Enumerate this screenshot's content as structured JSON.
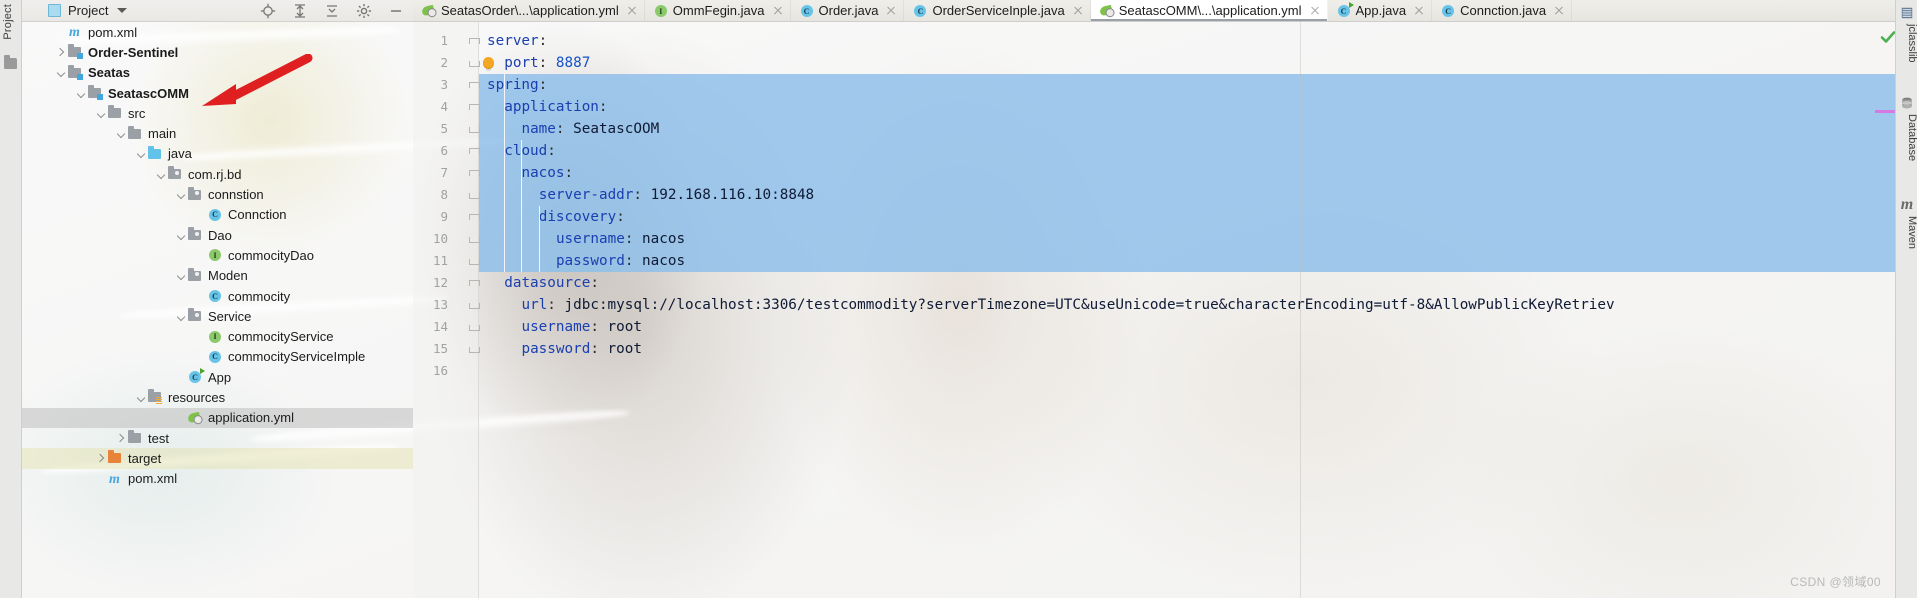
{
  "window": {
    "left_strip_label": "Project",
    "watermark": "CSDN @领域00"
  },
  "project_panel": {
    "title": "Project",
    "header_icons": [
      "locate-icon",
      "expand-all-icon",
      "collapse-all-icon",
      "settings-icon",
      "minimize-icon"
    ],
    "tree": [
      {
        "label": "pom.xml",
        "indent": 1,
        "icon": "maven-pom-icon",
        "arrow": "none",
        "bold": false,
        "state": "normal"
      },
      {
        "label": "Order-Sentinel",
        "indent": 1,
        "icon": "module-folder-icon",
        "arrow": "right",
        "bold": true,
        "state": "normal"
      },
      {
        "label": "Seatas",
        "indent": 1,
        "icon": "module-folder-icon",
        "arrow": "down",
        "bold": true,
        "state": "normal"
      },
      {
        "label": "SeatascOMM",
        "indent": 2,
        "icon": "module-folder-icon",
        "arrow": "down",
        "bold": true,
        "state": "normal"
      },
      {
        "label": "src",
        "indent": 3,
        "icon": "folder-icon",
        "arrow": "down",
        "bold": false,
        "state": "normal"
      },
      {
        "label": "main",
        "indent": 4,
        "icon": "folder-icon",
        "arrow": "down",
        "bold": false,
        "state": "normal"
      },
      {
        "label": "java",
        "indent": 5,
        "icon": "source-folder-icon",
        "arrow": "down",
        "bold": false,
        "state": "normal"
      },
      {
        "label": "com.rj.bd",
        "indent": 6,
        "icon": "package-icon",
        "arrow": "down",
        "bold": false,
        "state": "normal"
      },
      {
        "label": "connstion",
        "indent": 7,
        "icon": "package-icon",
        "arrow": "down",
        "bold": false,
        "state": "normal"
      },
      {
        "label": "Connction",
        "indent": 8,
        "icon": "class-icon",
        "arrow": "none",
        "bold": false,
        "state": "normal"
      },
      {
        "label": "Dao",
        "indent": 7,
        "icon": "package-icon",
        "arrow": "down",
        "bold": false,
        "state": "normal"
      },
      {
        "label": "commocityDao",
        "indent": 8,
        "icon": "interface-icon",
        "arrow": "none",
        "bold": false,
        "state": "normal"
      },
      {
        "label": "Moden",
        "indent": 7,
        "icon": "package-icon",
        "arrow": "down",
        "bold": false,
        "state": "normal"
      },
      {
        "label": "commocity",
        "indent": 8,
        "icon": "class-icon",
        "arrow": "none",
        "bold": false,
        "state": "normal"
      },
      {
        "label": "Service",
        "indent": 7,
        "icon": "package-icon",
        "arrow": "down",
        "bold": false,
        "state": "normal"
      },
      {
        "label": "commocityService",
        "indent": 8,
        "icon": "interface-icon",
        "arrow": "none",
        "bold": false,
        "state": "normal"
      },
      {
        "label": "commocityServiceImple",
        "indent": 8,
        "icon": "class-icon",
        "arrow": "none",
        "bold": false,
        "state": "normal"
      },
      {
        "label": "App",
        "indent": 7,
        "icon": "runnable-class-icon",
        "arrow": "none",
        "bold": false,
        "state": "normal"
      },
      {
        "label": "resources",
        "indent": 5,
        "icon": "resources-folder-icon",
        "arrow": "down",
        "bold": false,
        "state": "normal"
      },
      {
        "label": "application.yml",
        "indent": 7,
        "icon": "spring-yaml-icon",
        "arrow": "none",
        "bold": false,
        "state": "selected"
      },
      {
        "label": "test",
        "indent": 4,
        "icon": "folder-icon",
        "arrow": "right",
        "bold": false,
        "state": "normal"
      },
      {
        "label": "target",
        "indent": 3,
        "icon": "target-folder-icon",
        "arrow": "right",
        "bold": false,
        "state": "highlight"
      },
      {
        "label": "pom.xml",
        "indent": 3,
        "icon": "maven-pom-icon",
        "arrow": "none",
        "bold": false,
        "state": "normal"
      }
    ]
  },
  "editor": {
    "tabs": [
      {
        "label": "SeatasOrder\\...\\application.yml",
        "icon": "spring-yaml-icon",
        "active": false
      },
      {
        "label": "OmmFegin.java",
        "icon": "interface-icon",
        "active": false
      },
      {
        "label": "Order.java",
        "icon": "class-icon",
        "active": false
      },
      {
        "label": "OrderServiceInple.java",
        "icon": "class-icon",
        "active": false
      },
      {
        "label": "SeatascOMM\\...\\application.yml",
        "icon": "spring-yaml-icon",
        "active": true
      },
      {
        "label": "App.java",
        "icon": "runnable-class-icon",
        "active": false
      },
      {
        "label": "Connction.java",
        "icon": "class-icon",
        "active": false
      }
    ],
    "file_language": "yaml",
    "inspection_status": "ok-check-icon",
    "line_numbers": [
      1,
      2,
      3,
      4,
      5,
      6,
      7,
      8,
      9,
      10,
      11,
      12,
      13,
      14,
      15,
      16
    ],
    "code_lines": [
      {
        "n": 1,
        "indent": 0,
        "key": "server",
        "value": "",
        "selected": false
      },
      {
        "n": 2,
        "indent": 1,
        "key": "port",
        "value": "8887",
        "selected": false,
        "value_kind": "number",
        "gutter_hint": "intention-bulb-icon"
      },
      {
        "n": 3,
        "indent": 0,
        "key": "spring",
        "value": "",
        "selected": true
      },
      {
        "n": 4,
        "indent": 1,
        "key": "application",
        "value": "",
        "selected": true
      },
      {
        "n": 5,
        "indent": 2,
        "key": "name",
        "value": "SeatascOOM",
        "selected": true
      },
      {
        "n": 6,
        "indent": 1,
        "key": "cloud",
        "value": "",
        "selected": true
      },
      {
        "n": 7,
        "indent": 2,
        "key": "nacos",
        "value": "",
        "selected": true
      },
      {
        "n": 8,
        "indent": 3,
        "key": "server-addr",
        "value": "192.168.116.10:8848",
        "selected": true
      },
      {
        "n": 9,
        "indent": 3,
        "key": "discovery",
        "value": "",
        "selected": true
      },
      {
        "n": 10,
        "indent": 4,
        "key": "username",
        "value": "nacos",
        "selected": true
      },
      {
        "n": 11,
        "indent": 4,
        "key": "password",
        "value": "nacos",
        "selected": true
      },
      {
        "n": 12,
        "indent": 1,
        "key": "datasource",
        "value": "",
        "selected": false
      },
      {
        "n": 13,
        "indent": 2,
        "key": "url",
        "value": "jdbc:mysql://localhost:3306/testcommodity?serverTimezone=UTC&useUnicode=true&characterEncoding=utf-8&AllowPublicKeyRetriev",
        "selected": false
      },
      {
        "n": 14,
        "indent": 2,
        "key": "username",
        "value": "root",
        "selected": false
      },
      {
        "n": 15,
        "indent": 2,
        "key": "password",
        "value": "root",
        "selected": false
      },
      {
        "n": 16,
        "indent": 0,
        "key": "",
        "value": "",
        "selected": false
      }
    ]
  },
  "right_tool_strip": {
    "items": [
      {
        "label": "jclasslib",
        "icon": "jclasslib-icon"
      },
      {
        "label": "Database",
        "icon": "database-icon"
      },
      {
        "label": "Maven",
        "icon": "maven-icon"
      }
    ]
  },
  "colors": {
    "selection_blue": "#8fc0ea",
    "yaml_key": "#1a3fb0",
    "yaml_value": "#0f1a35",
    "yaml_number": "#1452c8",
    "annotation_arrow": "#e02020",
    "ok_check": "#4caf50",
    "marker_pink": "#d57ae0",
    "tree_selected": "#bebebe",
    "target_folder": "#e8833a"
  }
}
